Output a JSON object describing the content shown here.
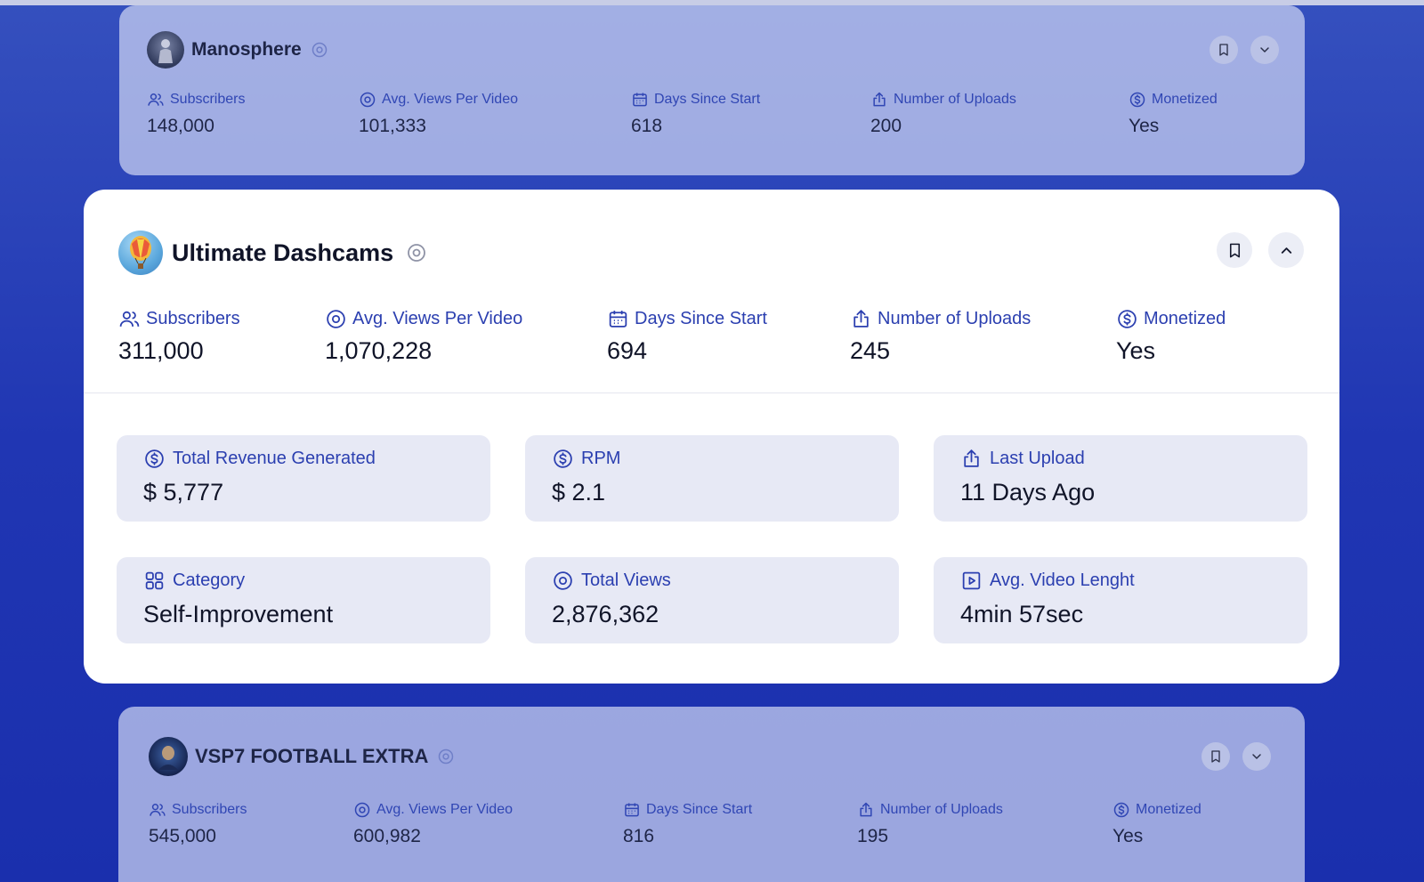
{
  "channels": [
    {
      "name": "Manosphere",
      "stats": {
        "subscribers": {
          "label": "Subscribers",
          "value": "148,000"
        },
        "avg_views": {
          "label": "Avg. Views Per Video",
          "value": "101,333"
        },
        "days": {
          "label": "Days Since Start",
          "value": "618"
        },
        "uploads": {
          "label": "Number of Uploads",
          "value": "200"
        },
        "monetized": {
          "label": "Monetized",
          "value": "Yes"
        }
      }
    },
    {
      "name": "Ultimate Dashcams",
      "stats": {
        "subscribers": {
          "label": "Subscribers",
          "value": "311,000"
        },
        "avg_views": {
          "label": "Avg. Views Per Video",
          "value": "1,070,228"
        },
        "days": {
          "label": "Days Since Start",
          "value": "694"
        },
        "uploads": {
          "label": "Number of Uploads",
          "value": "245"
        },
        "monetized": {
          "label": "Monetized",
          "value": "Yes"
        }
      },
      "details": {
        "revenue": {
          "label": "Total Revenue Generated",
          "value": "$ 5,777"
        },
        "rpm": {
          "label": "RPM",
          "value": "$ 2.1"
        },
        "last_upload": {
          "label": "Last Upload",
          "value": "11 Days Ago"
        },
        "category": {
          "label": "Category",
          "value": "Self-Improvement"
        },
        "total_views": {
          "label": "Total Views",
          "value": "2,876,362"
        },
        "avg_length": {
          "label": "Avg. Video Lenght",
          "value": "4min 57sec"
        }
      }
    },
    {
      "name": "VSP7 FOOTBALL EXTRA",
      "stats": {
        "subscribers": {
          "label": "Subscribers",
          "value": "545,000"
        },
        "avg_views": {
          "label": "Avg. Views Per Video",
          "value": "600,982"
        },
        "days": {
          "label": "Days Since Start",
          "value": "816"
        },
        "uploads": {
          "label": "Number of Uploads",
          "value": "195"
        },
        "monetized": {
          "label": "Monetized",
          "value": "Yes"
        }
      }
    }
  ],
  "colors": {
    "accent": "#2b3fb0",
    "background": "#2036b3",
    "tile": "#e7e9f5"
  },
  "icons": {
    "subscribers": "users-icon",
    "avg_views": "eye-icon",
    "days": "calendar-icon",
    "uploads": "upload-icon",
    "monetized": "dollar-icon",
    "category": "grid-icon",
    "avg_length": "play-icon",
    "bookmark": "bookmark-icon",
    "expand": "chevron-down-icon",
    "collapse": "chevron-up-icon"
  }
}
